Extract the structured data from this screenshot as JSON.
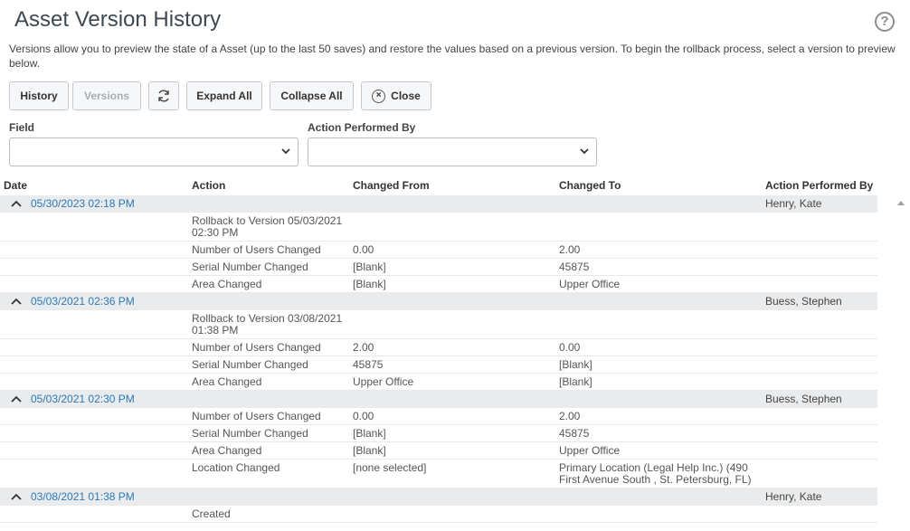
{
  "page": {
    "title": "Asset Version History",
    "description": "Versions allow you to preview the state of a Asset (up to the last 50 saves) and restore the values based on a previous version. To begin the rollback process, select a version to preview below.",
    "help_icon": "question-circle-icon"
  },
  "toolbar": {
    "history_label": "History",
    "versions_label": "Versions",
    "refresh_icon": "refresh-icon",
    "expand_label": "Expand All",
    "collapse_label": "Collapse All",
    "close_label": "Close",
    "close_icon": "close-circle-icon"
  },
  "filters": {
    "field_label": "Field",
    "field_value": "",
    "performed_by_label": "Action Performed By",
    "performed_by_value": ""
  },
  "table": {
    "headers": {
      "date": "Date",
      "action": "Action",
      "from": "Changed From",
      "to": "Changed To",
      "by": "Action Performed By"
    },
    "groups": [
      {
        "date": "05/30/2023 02:18 PM",
        "by": "Henry, Kate",
        "rows": [
          {
            "action": "Rollback to Version 05/03/2021 02:30 PM",
            "from": "",
            "to": ""
          },
          {
            "action": "Number of Users Changed",
            "from": "0.00",
            "to": "2.00"
          },
          {
            "action": "Serial Number Changed",
            "from": "[Blank]",
            "to": "45875"
          },
          {
            "action": "Area Changed",
            "from": "[Blank]",
            "to": "Upper Office"
          }
        ]
      },
      {
        "date": "05/03/2021 02:36 PM",
        "by": "Buess, Stephen",
        "rows": [
          {
            "action": "Rollback to Version 03/08/2021 01:38 PM",
            "from": "",
            "to": ""
          },
          {
            "action": "Number of Users Changed",
            "from": "2.00",
            "to": "0.00"
          },
          {
            "action": "Serial Number Changed",
            "from": "45875",
            "to": "[Blank]"
          },
          {
            "action": "Area Changed",
            "from": "Upper Office",
            "to": "[Blank]"
          }
        ]
      },
      {
        "date": "05/03/2021 02:30 PM",
        "by": "Buess, Stephen",
        "rows": [
          {
            "action": "Number of Users Changed",
            "from": "0.00",
            "to": "2.00"
          },
          {
            "action": "Serial Number Changed",
            "from": "[Blank]",
            "to": "45875"
          },
          {
            "action": "Area Changed",
            "from": "[Blank]",
            "to": "Upper Office"
          },
          {
            "action": "Location Changed",
            "from": "[none selected]",
            "to": "Primary Location (Legal Help Inc.) (490 First Avenue South , St. Petersburg, FL)"
          }
        ]
      },
      {
        "date": "03/08/2021 01:38 PM",
        "by": "Henry, Kate",
        "rows": [
          {
            "action": "Created",
            "from": "",
            "to": ""
          }
        ]
      }
    ]
  },
  "colors": {
    "link": "#2a7ab9",
    "group_bg": "#e9ebed",
    "title": "#3d4852"
  }
}
